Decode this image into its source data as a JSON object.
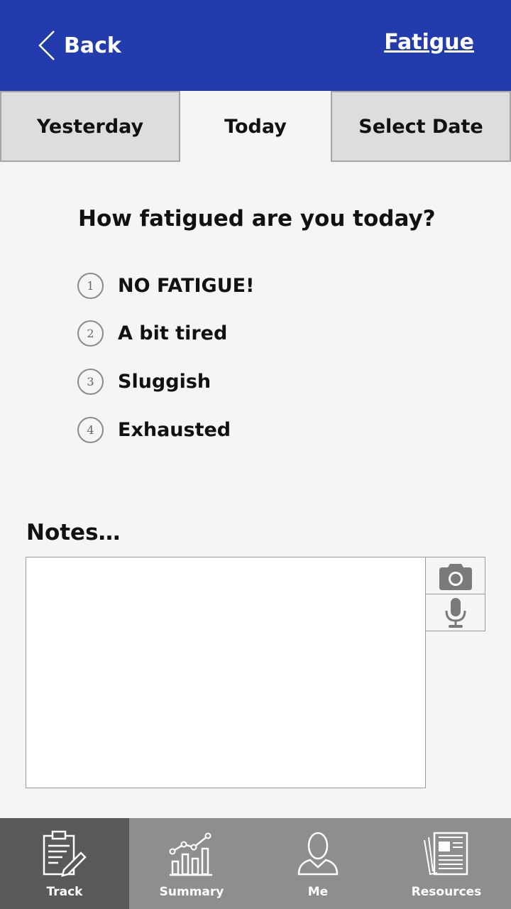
{
  "header": {
    "back_label": "Back",
    "title": "Fatigue",
    "background_color": "#233cad",
    "back_icon": "chevron-left-icon"
  },
  "tabs": [
    {
      "label": "Yesterday",
      "active": false
    },
    {
      "label": "Today",
      "active": true
    },
    {
      "label": "Select Date",
      "active": false
    }
  ],
  "question": "How fatigued are you today?",
  "options": [
    {
      "number": "1",
      "label": "NO FATIGUE!"
    },
    {
      "number": "2",
      "label": "A bit tired"
    },
    {
      "number": "3",
      "label": "Sluggish"
    },
    {
      "number": "4",
      "label": "Exhausted"
    }
  ],
  "notes": {
    "label": "Notes…",
    "value": "",
    "camera_icon": "camera-icon",
    "mic_icon": "microphone-icon"
  },
  "bottom_nav": [
    {
      "label": "Track",
      "icon": "clipboard-pencil-icon",
      "active": true
    },
    {
      "label": "Summary",
      "icon": "chart-icon",
      "active": false
    },
    {
      "label": "Me",
      "icon": "person-icon",
      "active": false
    },
    {
      "label": "Resources",
      "icon": "newspaper-icon",
      "active": false
    }
  ]
}
